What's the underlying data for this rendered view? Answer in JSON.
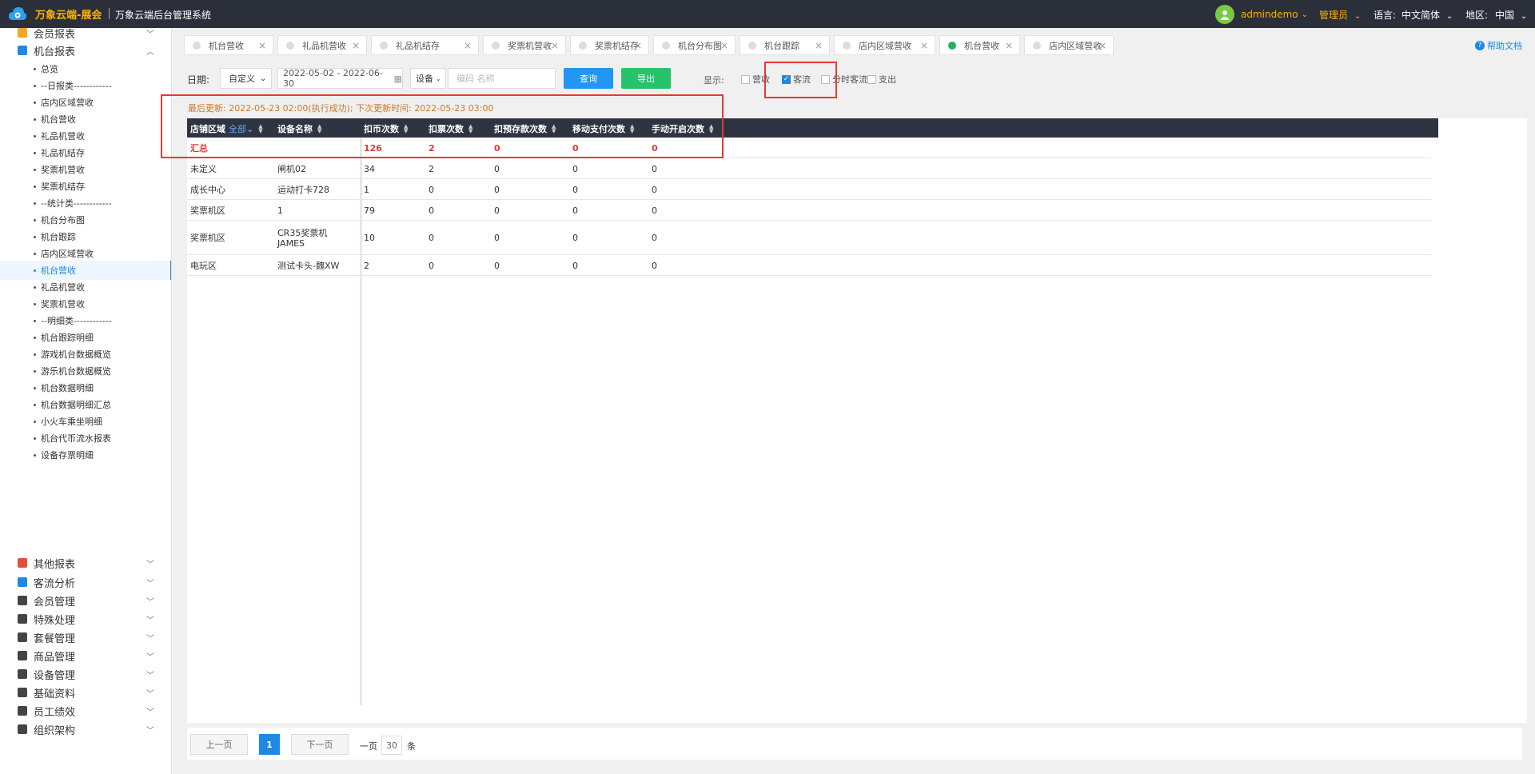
{
  "header": {
    "brand": "万象云端-展会",
    "system_title": "万象云端后台管理系统",
    "username": "admindemo",
    "role": "管理员",
    "lang_label": "语言:",
    "lang": "中文简体",
    "region_label": "地区:",
    "region": "中国"
  },
  "sidebar": {
    "top_items": [
      {
        "label": "会员报表",
        "color": "#f5a623"
      },
      {
        "label": "机台报表",
        "color": "#1e88e5"
      },
      {
        "label": "其他报表",
        "color": "#e55039"
      },
      {
        "label": "客流分析",
        "color": "#1e88e5"
      },
      {
        "label": "会员管理",
        "color": "#444"
      },
      {
        "label": "特殊处理",
        "color": "#444"
      },
      {
        "label": "套餐管理",
        "color": "#444"
      },
      {
        "label": "商品管理",
        "color": "#444"
      },
      {
        "label": "设备管理",
        "color": "#444"
      },
      {
        "label": "基础资料",
        "color": "#444"
      },
      {
        "label": "员工绩效",
        "color": "#444"
      },
      {
        "label": "组织架构",
        "color": "#444"
      }
    ],
    "sub_items": [
      "总览",
      "--日报类------------",
      "店内区域营收",
      "机台营收",
      "礼品机营收",
      "礼品机结存",
      "奖票机营收",
      "奖票机结存",
      "--统计类------------",
      "机台分布图",
      "机台跟踪",
      "店内区域营收",
      "机台营收",
      "礼品机营收",
      "奖票机营收",
      "--明细类------------",
      "机台跟踪明细",
      "游戏机台数据概览",
      "游乐机台数据概览",
      "机台数据明细",
      "机台数据明细汇总",
      "小火车乘坐明细",
      "机台代币流水报表",
      "设备存票明细"
    ]
  },
  "tabs": [
    "机台营收",
    "礼品机营收",
    "礼品机结存",
    "奖票机营收",
    "奖票机结存",
    "机台分布图",
    "机台跟踪",
    "店内区域营收",
    "机台营收",
    "店内区域营收"
  ],
  "help": "帮助文档",
  "filter": {
    "date_label": "日期:",
    "date_mode": "自定义",
    "date_range": "2022-05-02 - 2022-06-30",
    "device_select": "设备",
    "device_placeholder": "编码 名称",
    "query": "查询",
    "export": "导出",
    "display_label": "显示:",
    "options": [
      {
        "label": "营收",
        "checked": false
      },
      {
        "label": "客流",
        "checked": true
      },
      {
        "label": "分时客流",
        "checked": false
      },
      {
        "label": "支出",
        "checked": false
      }
    ]
  },
  "update_info": "最后更新: 2022-05-23 02:00(执行成功); 下次更新时间: 2022-05-23 03:00",
  "table": {
    "headers": [
      "店铺区域",
      "设备名称",
      "扣币次数",
      "扣票次数",
      "扣预存款次数",
      "移动支付次数",
      "手动开启次数"
    ],
    "region_filter": "全部",
    "total": [
      "汇总",
      "",
      "126",
      "2",
      "0",
      "0",
      "0"
    ],
    "rows": [
      [
        "未定义",
        "闸机02",
        "34",
        "2",
        "0",
        "0",
        "0"
      ],
      [
        "成长中心",
        "运动打卡728",
        "1",
        "0",
        "0",
        "0",
        "0"
      ],
      [
        "奖票机区",
        "1",
        "79",
        "0",
        "0",
        "0",
        "0"
      ],
      [
        "奖票机区",
        "CR35奖票机\nJAMES",
        "10",
        "0",
        "0",
        "0",
        "0"
      ],
      [
        "电玩区",
        "测试卡头-魏XW",
        "2",
        "0",
        "0",
        "0",
        "0"
      ]
    ]
  },
  "pager": {
    "prev": "上一页",
    "current": "1",
    "next": "下一页",
    "per_label": "一页",
    "per_value": "30",
    "per_unit": "条"
  }
}
